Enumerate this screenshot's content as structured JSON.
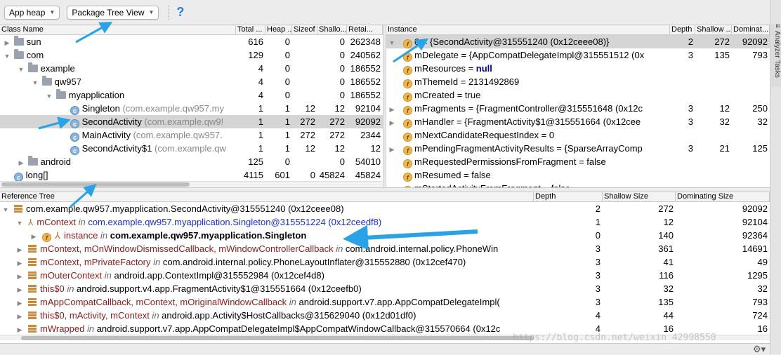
{
  "toolbar": {
    "heap_select": "App heap",
    "view_select": "Package Tree View",
    "help": "?"
  },
  "side_tab": {
    "label": "Analyzer Tasks"
  },
  "class_table": {
    "headers": [
      "Class Name",
      "Total ...",
      "Heap ...",
      "Sizeof",
      "Shallo...",
      "Retai..."
    ],
    "rows": [
      {
        "name": "sun",
        "kind": "folder",
        "expand": "▶",
        "indent": 0,
        "total": "616",
        "heap": "0",
        "sizeof": "",
        "shallow": "0",
        "retained": "262348"
      },
      {
        "name": "com",
        "kind": "folder",
        "expand": "▼",
        "indent": 0,
        "total": "129",
        "heap": "0",
        "sizeof": "",
        "shallow": "0",
        "retained": "240562"
      },
      {
        "name": "example",
        "kind": "folder",
        "expand": "▼",
        "indent": 1,
        "total": "4",
        "heap": "0",
        "sizeof": "",
        "shallow": "0",
        "retained": "186552"
      },
      {
        "name": "qw957",
        "kind": "folder",
        "expand": "▼",
        "indent": 2,
        "total": "4",
        "heap": "0",
        "sizeof": "",
        "shallow": "0",
        "retained": "186552"
      },
      {
        "name": "myapplication",
        "kind": "folder",
        "expand": "▼",
        "indent": 3,
        "total": "4",
        "heap": "0",
        "sizeof": "",
        "shallow": "0",
        "retained": "186552"
      },
      {
        "name": "Singleton",
        "pkg": " (com.example.qw957.my",
        "kind": "class",
        "expand": "",
        "indent": 4,
        "total": "1",
        "heap": "1",
        "sizeof": "12",
        "shallow": "12",
        "retained": "92104"
      },
      {
        "name": "SecondActivity",
        "pkg": " (com.example.qw9!",
        "kind": "class",
        "expand": "",
        "indent": 4,
        "total": "1",
        "heap": "1",
        "sizeof": "272",
        "shallow": "272",
        "retained": "92092",
        "selected": true
      },
      {
        "name": "MainActivity",
        "pkg": " (com.example.qw957.",
        "kind": "class",
        "expand": "",
        "indent": 4,
        "total": "1",
        "heap": "1",
        "sizeof": "272",
        "shallow": "272",
        "retained": "2344"
      },
      {
        "name": "SecondActivity$1",
        "pkg": " (com.example.qw",
        "kind": "class",
        "expand": "",
        "indent": 4,
        "total": "1",
        "heap": "1",
        "sizeof": "12",
        "shallow": "12",
        "retained": "12"
      },
      {
        "name": "android",
        "kind": "folder",
        "expand": "▶",
        "indent": 1,
        "total": "125",
        "heap": "0",
        "sizeof": "",
        "shallow": "0",
        "retained": "54010"
      },
      {
        "name": "long[]",
        "kind": "class",
        "expand": "",
        "indent": 0,
        "total": "4115",
        "heap": "601",
        "sizeof": "0",
        "shallow": "45824",
        "retained": "45824"
      }
    ]
  },
  "instance_table": {
    "headers": [
      "Instance",
      "Depth",
      "Shallow ...",
      "Dominat..."
    ],
    "rows": [
      {
        "expand": "▼",
        "icon": "f",
        "text": "0 = {SecondActivity@315551240 (0x12ceee08)}",
        "depth": "2",
        "shallow": "272",
        "dominating": "92092",
        "selected": true
      },
      {
        "expand": "",
        "icon": "f",
        "text": "mDelegate = {AppCompatDelegateImpl@315551512 (0x",
        "depth": "3",
        "shallow": "135",
        "dominating": "793"
      },
      {
        "expand": "",
        "icon": "f",
        "field": "mResources = ",
        "kw": "null",
        "depth": "",
        "shallow": "",
        "dominating": ""
      },
      {
        "expand": "",
        "icon": "f",
        "text": "mThemeId = 2131492869",
        "depth": "",
        "shallow": "",
        "dominating": ""
      },
      {
        "expand": "",
        "icon": "f",
        "text": "mCreated = true",
        "depth": "",
        "shallow": "",
        "dominating": ""
      },
      {
        "expand": "▶",
        "icon": "f",
        "text": "mFragments = {FragmentController@315551648 (0x12c",
        "depth": "3",
        "shallow": "12",
        "dominating": "250"
      },
      {
        "expand": "▶",
        "icon": "f",
        "text": "mHandler = {FragmentActivity$1@315551664 (0x12cee",
        "depth": "3",
        "shallow": "32",
        "dominating": "32"
      },
      {
        "expand": "",
        "icon": "f",
        "text": "mNextCandidateRequestIndex = 0",
        "depth": "",
        "shallow": "",
        "dominating": ""
      },
      {
        "expand": "▶",
        "icon": "f",
        "text": "mPendingFragmentActivityResults = {SparseArrayComp",
        "depth": "3",
        "shallow": "21",
        "dominating": "125"
      },
      {
        "expand": "",
        "icon": "f",
        "text": "mRequestedPermissionsFromFragment = false",
        "depth": "",
        "shallow": "",
        "dominating": ""
      },
      {
        "expand": "",
        "icon": "f",
        "text": "mResumed = false",
        "depth": "",
        "shallow": "",
        "dominating": ""
      },
      {
        "expand": "",
        "icon": "f",
        "text": "mStartedActivityFromFragment = false",
        "depth": "",
        "shallow": "",
        "dominating": ""
      }
    ]
  },
  "reference_tree": {
    "headers": [
      "Reference Tree",
      "Depth",
      "Shallow Size",
      "Dominating Size"
    ],
    "rows": [
      {
        "expand": "▼",
        "indent": 0,
        "icon": "obj",
        "parts": [
          {
            "t": "com.example.qw957.myapplication.SecondActivity@315551240 (0x12ceee08)",
            "c": ""
          }
        ],
        "depth": "2",
        "shallow": "272",
        "dominating": "92092"
      },
      {
        "expand": "▼",
        "indent": 1,
        "icon": "tree",
        "parts": [
          {
            "t": "mContext",
            "c": "red"
          },
          {
            "t": " in ",
            "c": "it"
          },
          {
            "t": "com.example.qw957.myapplication.Singleton@315551224 (0x12ceedf8)",
            "c": "blue"
          }
        ],
        "depth": "1",
        "shallow": "12",
        "dominating": "92104"
      },
      {
        "expand": "▶",
        "indent": 2,
        "icon": "f-tree",
        "parts": [
          {
            "t": "instance",
            "c": "red"
          },
          {
            "t": " in ",
            "c": "it"
          },
          {
            "t": "com.example.qw957.myapplication.Singleton",
            "c": "bold"
          }
        ],
        "depth": "0",
        "shallow": "140",
        "dominating": "92364"
      },
      {
        "expand": "▶",
        "indent": 1,
        "icon": "obj",
        "parts": [
          {
            "t": "mContext, mOnWindowDismissedCallback, mWindowControllerCallback",
            "c": "red"
          },
          {
            "t": " in ",
            "c": "it"
          },
          {
            "t": "com.android.internal.policy.PhoneWin",
            "c": ""
          }
        ],
        "depth": "3",
        "shallow": "361",
        "dominating": "14691"
      },
      {
        "expand": "▶",
        "indent": 1,
        "icon": "obj",
        "parts": [
          {
            "t": "mContext, mPrivateFactory",
            "c": "red"
          },
          {
            "t": " in ",
            "c": "it"
          },
          {
            "t": "com.android.internal.policy.PhoneLayoutInflater@315552880 (0x12cef470)",
            "c": ""
          }
        ],
        "depth": "3",
        "shallow": "41",
        "dominating": "49"
      },
      {
        "expand": "▶",
        "indent": 1,
        "icon": "obj",
        "parts": [
          {
            "t": "mOuterContext",
            "c": "red"
          },
          {
            "t": " in ",
            "c": "it"
          },
          {
            "t": "android.app.ContextImpl@315552984 (0x12cef4d8)",
            "c": ""
          }
        ],
        "depth": "3",
        "shallow": "116",
        "dominating": "1295"
      },
      {
        "expand": "▶",
        "indent": 1,
        "icon": "obj",
        "parts": [
          {
            "t": "this$0",
            "c": "red"
          },
          {
            "t": " in ",
            "c": "it"
          },
          {
            "t": "android.support.v4.app.FragmentActivity$1@315551664 (0x12ceefb0)",
            "c": ""
          }
        ],
        "depth": "3",
        "shallow": "32",
        "dominating": "32"
      },
      {
        "expand": "▶",
        "indent": 1,
        "icon": "obj",
        "parts": [
          {
            "t": "mAppCompatCallback, mContext, mOriginalWindowCallback",
            "c": "red"
          },
          {
            "t": " in ",
            "c": "it"
          },
          {
            "t": "android.support.v7.app.AppCompatDelegateImpl(",
            "c": ""
          }
        ],
        "depth": "3",
        "shallow": "135",
        "dominating": "793"
      },
      {
        "expand": "▶",
        "indent": 1,
        "icon": "obj",
        "parts": [
          {
            "t": "this$0, mActivity, mContext",
            "c": "red"
          },
          {
            "t": " in ",
            "c": "it"
          },
          {
            "t": "android.app.Activity$HostCallbacks@315629040 (0x12d01df0)",
            "c": ""
          }
        ],
        "depth": "4",
        "shallow": "44",
        "dominating": "724"
      },
      {
        "expand": "▶",
        "indent": 1,
        "icon": "obj",
        "parts": [
          {
            "t": "mWrapped",
            "c": "red"
          },
          {
            "t": " in ",
            "c": "it"
          },
          {
            "t": "android.support.v7.app.AppCompatDelegateImpl$AppCompatWindowCallback@315570664 (0x12c",
            "c": ""
          }
        ],
        "depth": "4",
        "shallow": "16",
        "dominating": "16"
      }
    ]
  },
  "watermark": "https://blog.csdn.net/weixin_42998550",
  "colors": {
    "accent_arrow": "#29a3e6",
    "selection": "#d5d5d5",
    "field_red": "#8b1a1a",
    "link_blue": "#1a2ed0"
  }
}
